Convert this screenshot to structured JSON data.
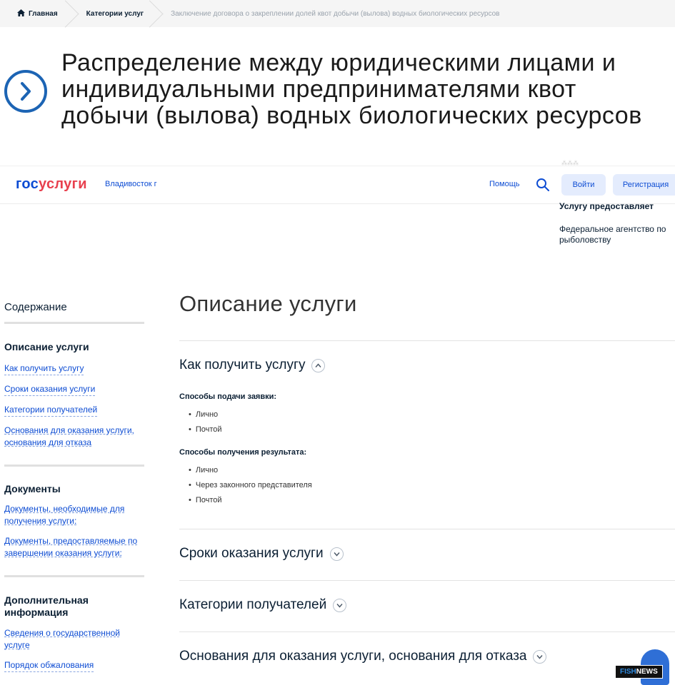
{
  "breadcrumb": {
    "home": "Главная",
    "category": "Категории услуг",
    "current": "Заключение договора о закреплении долей квот добычи (вылова) водных биологических ресурсов"
  },
  "page_title": "Распределение между юридическими лицами и индивидуальными предпринимателями квот добычи (вылова) водных биологических ресурсов",
  "header": {
    "logo_gos": "гос",
    "logo_uslugi": "услуги",
    "city": "Владивосток г",
    "help": "Помощь",
    "login": "Войти",
    "register": "Регистрация"
  },
  "provider": {
    "title": "Услугу предоставляет",
    "name": "Федеральное агентство по рыболовству"
  },
  "sidebar": {
    "heading": "Содержание",
    "sections": [
      {
        "title": "Описание услуги",
        "links": [
          "Как получить услугу",
          "Сроки оказания услуги",
          "Категории получателей",
          "Основания для оказания услуги, основания для отказа"
        ]
      },
      {
        "title": "Документы",
        "links": [
          "Документы, необходимые для получения услуги:",
          "Документы, предоставляемые по завершении оказания услуги:"
        ]
      },
      {
        "title": "Дополнительная информация",
        "links": [
          "Сведения о государственной услуге",
          "Порядок обжалования"
        ]
      }
    ]
  },
  "main": {
    "title": "Описание услуги",
    "accordion": [
      {
        "title": "Как получить услугу",
        "expanded": true,
        "apply_heading": "Способы подачи заявки:",
        "apply_methods": [
          "Лично",
          "Почтой"
        ],
        "result_heading": "Способы получения результата:",
        "result_methods": [
          "Лично",
          "Через законного представителя",
          "Почтой"
        ]
      },
      {
        "title": "Сроки оказания услуги",
        "expanded": false
      },
      {
        "title": "Категории получателей",
        "expanded": false
      },
      {
        "title": "Основания для оказания услуги, основания для отказа",
        "expanded": false
      }
    ]
  },
  "watermark": {
    "fish": "FISH",
    "news": "NEWS"
  },
  "colors": {
    "accent": "#0d4cd3",
    "brand_red": "#e8404e",
    "title_circle": "#1c64b4"
  }
}
